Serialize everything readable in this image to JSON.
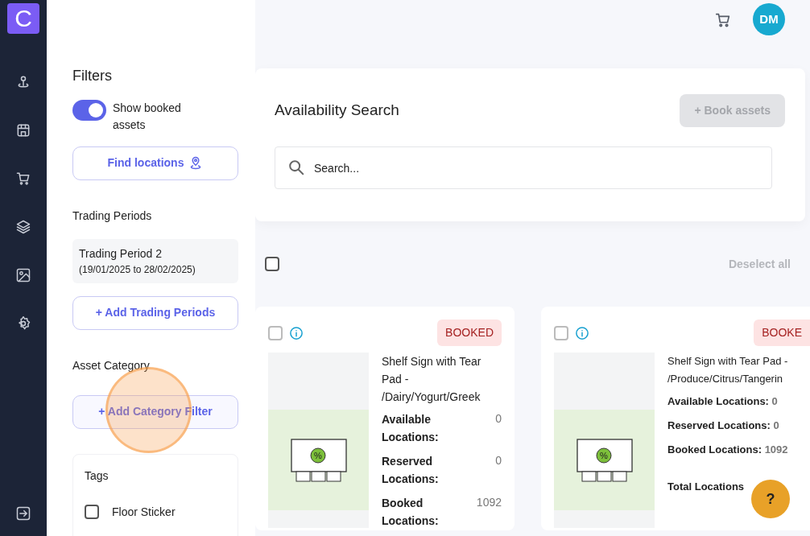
{
  "sidebar": {
    "logo": "C",
    "items": [
      {
        "kind": "pin"
      },
      {
        "kind": "store"
      },
      {
        "kind": "cart"
      },
      {
        "kind": "layers"
      },
      {
        "kind": "image"
      },
      {
        "kind": "settings"
      }
    ],
    "logout": {
      "kind": "logout"
    }
  },
  "header": {
    "avatar": "DM"
  },
  "filters": {
    "title": "Filters",
    "show_booked": {
      "label": "Show booked assets",
      "on": true
    },
    "find_locations": "Find locations",
    "trading_periods_title": "Trading Periods",
    "trading_periods": [
      {
        "name": "Trading Period 2",
        "range": "(19/01/2025 to 28/02/2025)"
      }
    ],
    "add_trading_periods": "+ Add Trading Periods",
    "asset_category_title": "Asset Category",
    "add_category_filter": "+ Add Category Filter",
    "tags_title": "Tags",
    "tags": [
      {
        "label": "Floor Sticker",
        "checked": false
      }
    ]
  },
  "search_panel": {
    "title": "Availability Search",
    "book_button": {
      "label": "+ Book assets",
      "disabled": true
    },
    "search": {
      "placeholder": "Search..."
    }
  },
  "select_all": {
    "checked": false,
    "deselect": "Deselect all"
  },
  "assets": [
    {
      "kind": "stacked",
      "image_symbol": "%",
      "checked": false,
      "status": "BOOKED",
      "title": "Shelf Sign with Tear Pad - /Dairy/Yogurt/Greek",
      "stats": [
        {
          "label": "Available Locations:",
          "value": "0"
        },
        {
          "label": "Reserved Locations:",
          "value": "0"
        },
        {
          "label": "Booked Locations:",
          "value": "1092"
        }
      ]
    },
    {
      "kind": "inline",
      "image_symbol": "%",
      "checked": false,
      "status": "BOOKE",
      "title": "Shelf Sign with Tear Pad - /Produce/Citrus/Tangerin",
      "stats": [
        {
          "label": "Available Locations:",
          "value": "0"
        },
        {
          "label": "Reserved Locations:",
          "value": "0"
        },
        {
          "label": "Booked Locations:",
          "value": "1092"
        },
        {
          "label": "Total Locations"
        }
      ]
    }
  ],
  "help": "?"
}
